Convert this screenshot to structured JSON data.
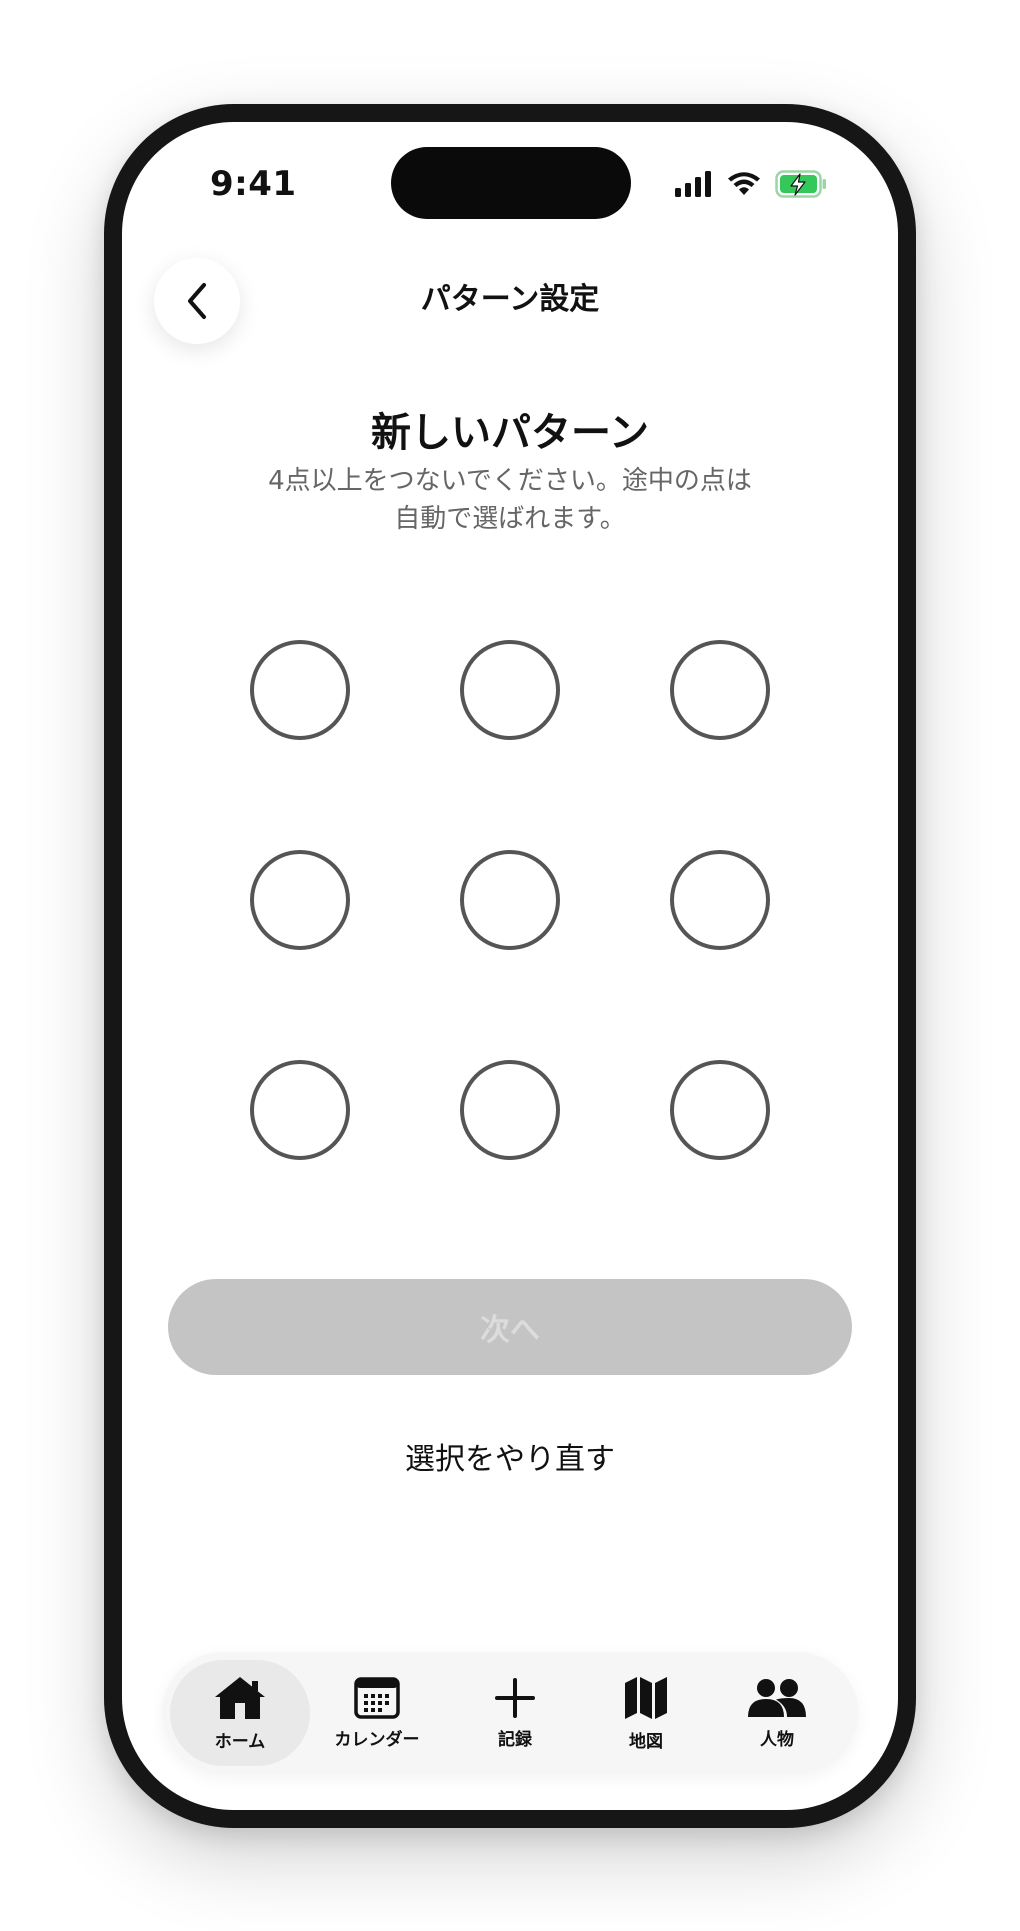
{
  "status_bar": {
    "time": "9:41",
    "battery_color": "#34c759",
    "icons": [
      "cellular-signal-icon",
      "wifi-icon",
      "battery-charging-icon"
    ]
  },
  "nav": {
    "title": "パターン設定",
    "back_icon": "chevron-left-icon"
  },
  "content": {
    "heading": "新しいパターン",
    "subtext_line1": "4点以上をつないでください。途中の点は",
    "subtext_line2": "自動で選ばれます。"
  },
  "pattern": {
    "rows": 3,
    "cols": 3,
    "dot_color": "#555555",
    "selected": []
  },
  "actions": {
    "next_label": "次へ",
    "next_enabled": false,
    "reset_label": "選択をやり直す"
  },
  "tab_bar": {
    "items": [
      {
        "label": "ホーム",
        "icon": "home-icon",
        "active": true
      },
      {
        "label": "カレンダー",
        "icon": "calendar-icon",
        "active": false
      },
      {
        "label": "記録",
        "icon": "plus-icon",
        "active": false
      },
      {
        "label": "地図",
        "icon": "map-icon",
        "active": false
      },
      {
        "label": "人物",
        "icon": "people-icon",
        "active": false
      }
    ]
  }
}
